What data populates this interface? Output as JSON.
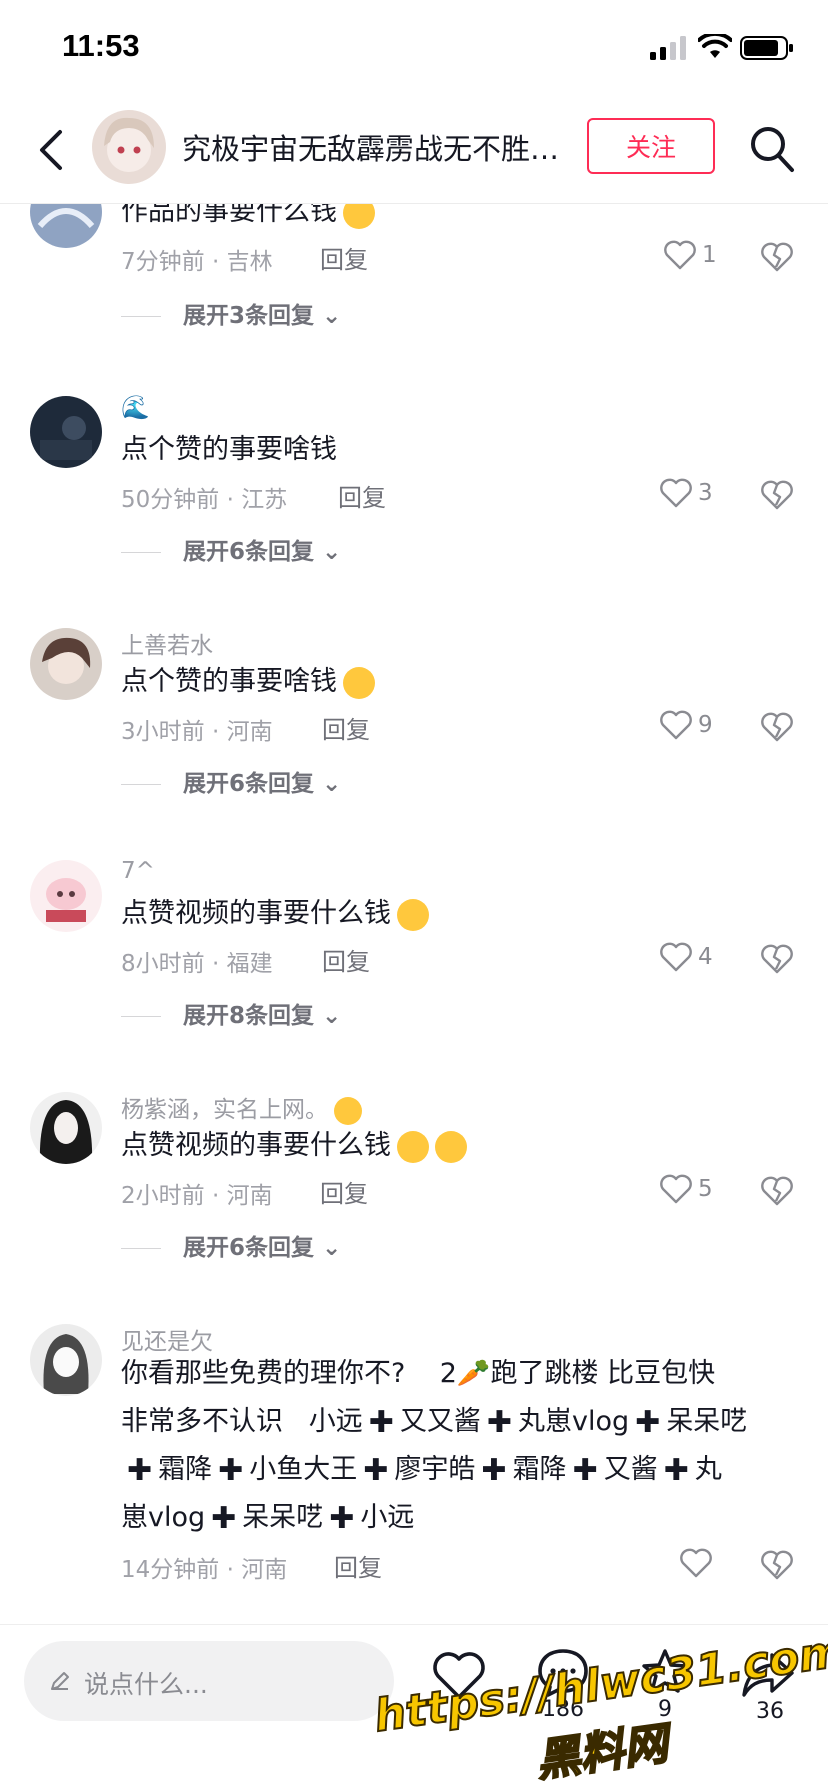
{
  "status_bar": {
    "time": "11:53"
  },
  "header": {
    "title": "究极宇宙无敌霹雳战无不胜世…",
    "follow_label": "关注"
  },
  "comments": [
    {
      "username": "",
      "text": "作品的事要什么钱",
      "meta": "7分钟前 · 吉林",
      "reply_label": "回复",
      "likes": "1",
      "expand": "展开3条回复"
    },
    {
      "username": "🌊",
      "text": "点个赞的事要啥钱",
      "meta": "50分钟前 · 江苏",
      "reply_label": "回复",
      "likes": "3",
      "expand": "展开6条回复"
    },
    {
      "username": "上善若水",
      "text": "点个赞的事要啥钱",
      "meta": "3小时前 · 河南",
      "reply_label": "回复",
      "likes": "9",
      "expand": "展开6条回复"
    },
    {
      "username": "7^",
      "text": "点赞视频的事要什么钱",
      "meta": "8小时前 · 福建",
      "reply_label": "回复",
      "likes": "4",
      "expand": "展开8条回复"
    },
    {
      "username": "杨紫涵，实名上网。",
      "text": "点赞视频的事要什么钱",
      "meta": "2小时前 · 河南",
      "reply_label": "回复",
      "likes": "5",
      "expand": "展开6条回复"
    },
    {
      "username": "见还是欠",
      "text_line1": "你看那些免费的理你不?",
      "text_line1b": "2",
      "text_line1c": "跑了跳楼 比豆包快",
      "text_line2a": "非常多不认识",
      "text_line2b": "小远",
      "text_line2c": "又又酱",
      "text_line2d": "丸崽vlog",
      "text_line2e": "呆呆呓",
      "text_line3a": "霜降",
      "text_line3b": "小鱼大王",
      "text_line3c": "廖宇皓",
      "text_line3d": "霜降",
      "text_line3e": "又酱",
      "text_line3f": "丸",
      "text_line4a": "崽vlog",
      "text_line4b": "呆呆呓",
      "text_line4c": "小远",
      "meta": "14分钟前 · 河南",
      "reply_label": "回复",
      "likes": ""
    }
  ],
  "bottom_bar": {
    "input_placeholder": "说点什么...",
    "comment_count": "186",
    "favorite_count": "9",
    "share_count": "36"
  },
  "watermark": {
    "line1": "https://hlwc31.com",
    "line2": "黑料网"
  },
  "colors": {
    "accent": "#fe2c55",
    "text": "#161823",
    "muted": "#a0a1a8"
  }
}
